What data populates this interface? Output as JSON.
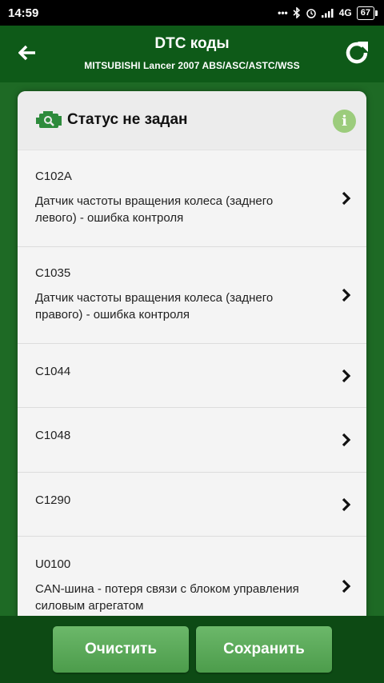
{
  "status_bar": {
    "time": "14:59",
    "network": "4G",
    "battery": "67"
  },
  "app_bar": {
    "title": "DTC коды",
    "subtitle": "MITSUBISHI Lancer 2007 ABS/ASC/ASTC/WSS"
  },
  "card": {
    "title": "Статус не задан",
    "info_glyph": "i"
  },
  "dtc_items": [
    {
      "code": "C102A",
      "desc_line1": "Датчик частоты вращения колеса (заднего",
      "desc_line2": "левого) - ошибка контроля"
    },
    {
      "code": "C1035",
      "desc_line1": "Датчик частоты вращения колеса (заднего",
      "desc_line2": "правого) - ошибка контроля"
    },
    {
      "code": "C1044"
    },
    {
      "code": "C1048"
    },
    {
      "code": "C1290"
    },
    {
      "code": "U0100",
      "desc_line1": "CAN-шина - потеря связи с блоком управления",
      "desc_line2": "силовым агрегатом"
    }
  ],
  "buttons": {
    "clear": "Очистить",
    "save": "Сохранить"
  },
  "colors": {
    "app_bar": "#0e5a18",
    "content_bg": "#1e6a25",
    "button": "#5aab58",
    "info_icon": "#9ccc7c",
    "engine_icon": "#2e8b3c"
  }
}
